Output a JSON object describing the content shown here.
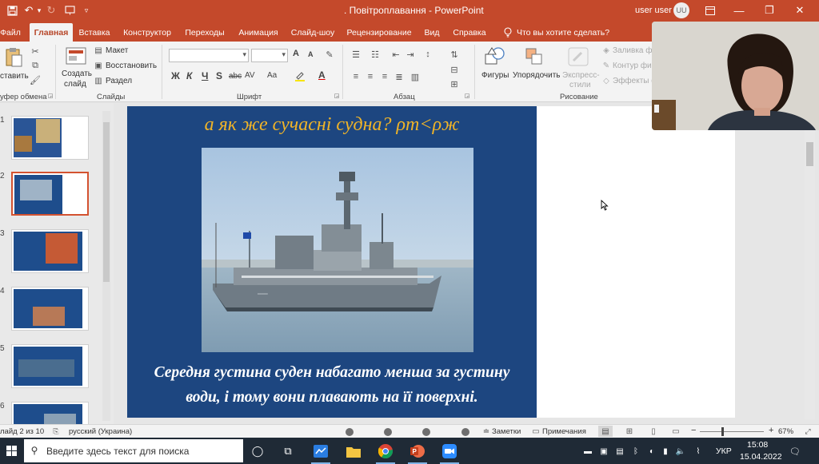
{
  "window": {
    "title": ". Повітроплавання - PowerPoint",
    "user_name": "user user",
    "user_initials": "UU"
  },
  "tabs": [
    "Файл",
    "Главная",
    "Вставка",
    "Конструктор",
    "Переходы",
    "Анимация",
    "Слайд-шоу",
    "Рецензирование",
    "Вид",
    "Справка"
  ],
  "active_tab": "Главная",
  "tell_me": "Что вы хотите сделать?",
  "ribbon": {
    "clipboard": {
      "paste": "ставить",
      "label": "уфер обмена"
    },
    "slides": {
      "new_slide_line1": "Создать",
      "new_slide_line2": "слайд",
      "layout": "Макет",
      "reset": "Восстановить",
      "section": "Раздел",
      "label": "Слайды"
    },
    "font": {
      "label": "Шрифт",
      "bold": "Ж",
      "italic": "К",
      "underline": "Ч",
      "shadow": "S",
      "strike": "abc",
      "spacing": "AV",
      "case": "Aa",
      "color": "A",
      "grow": "A",
      "shrink": "A"
    },
    "paragraph": {
      "label": "Абзац"
    },
    "drawing": {
      "shapes": "Фигуры",
      "arrange": "Упорядочить",
      "quick_styles_line1": "Экспресс-",
      "quick_styles_line2": "стили",
      "fill": "Заливка фи",
      "outline": "Контур фи",
      "effects": "Эффекты ф",
      "label": "Рисование"
    }
  },
  "thumbnails": [
    {
      "number": "1"
    },
    {
      "number": "2",
      "selected": true
    },
    {
      "number": "3"
    },
    {
      "number": "4"
    },
    {
      "number": "5"
    },
    {
      "number": "6"
    }
  ],
  "slide": {
    "heading": "а як же сучасні судна? ρт<ρж",
    "body_line1": "Середня густина суден набагато менша за густину",
    "body_line2": "води, і тому вони плавають на її поверхні."
  },
  "status": {
    "slide_counter": "лайд 2 из 10",
    "language": "русский (Украина)",
    "notes": "Заметки",
    "comments": "Примечания",
    "zoom": "67%",
    "zoom_fraction": 0.67
  },
  "taskbar": {
    "search_placeholder": "Введите здесь текст для поиска",
    "lang": "УКР",
    "time": "15:08",
    "date": "15.04.2022"
  },
  "colors": {
    "accent": "#c4492b",
    "slide_bg": "#1d4680",
    "heading": "#f0b428"
  }
}
